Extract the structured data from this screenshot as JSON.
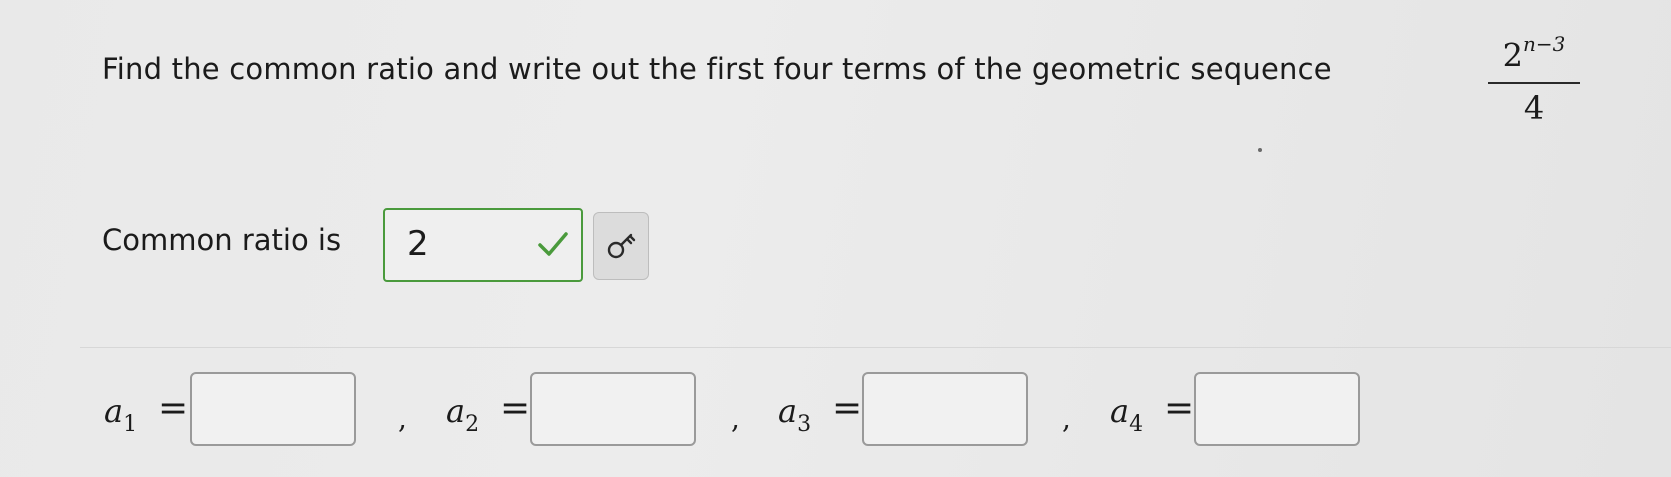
{
  "question": {
    "text": "Find the common ratio and write out the first four terms of the geometric sequence",
    "formula_base": "2",
    "formula_exponent": "n−3",
    "formula_denominator": "4"
  },
  "ratio": {
    "label": "Common ratio is",
    "value": "2",
    "status": "correct",
    "check_icon": "check-icon",
    "key_icon": "key-icon",
    "accent_color": "#4a9a3c"
  },
  "terms": [
    {
      "var": "a",
      "sub": "1",
      "eq": "=",
      "value": ""
    },
    {
      "var": "a",
      "sub": "2",
      "eq": "=",
      "value": ""
    },
    {
      "var": "a",
      "sub": "3",
      "eq": "=",
      "value": ""
    },
    {
      "var": "a",
      "sub": "4",
      "eq": "=",
      "value": ""
    }
  ],
  "separator": ","
}
